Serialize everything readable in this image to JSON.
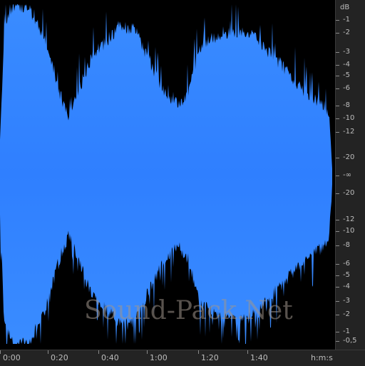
{
  "db_scale": {
    "unit": "dB",
    "labels": [
      "-1",
      "-2",
      "-3",
      "-4",
      "-5",
      "-6",
      "-8",
      "-10",
      "-12",
      "-20",
      "-∞",
      "-20",
      "-12",
      "-10",
      "-8",
      "-6",
      "-5",
      "-4",
      "-3",
      "-2",
      "-1",
      "-0,5"
    ]
  },
  "time_scale": {
    "labels": [
      "0:00",
      "0:20",
      "0:40",
      "1:00",
      "1:20",
      "1:40"
    ],
    "unit": "h:m:s"
  },
  "watermark": "Sound-Pack.Net",
  "colors": {
    "waveform": "#3a8cff",
    "background": "#000000",
    "ruler": "#232323"
  }
}
